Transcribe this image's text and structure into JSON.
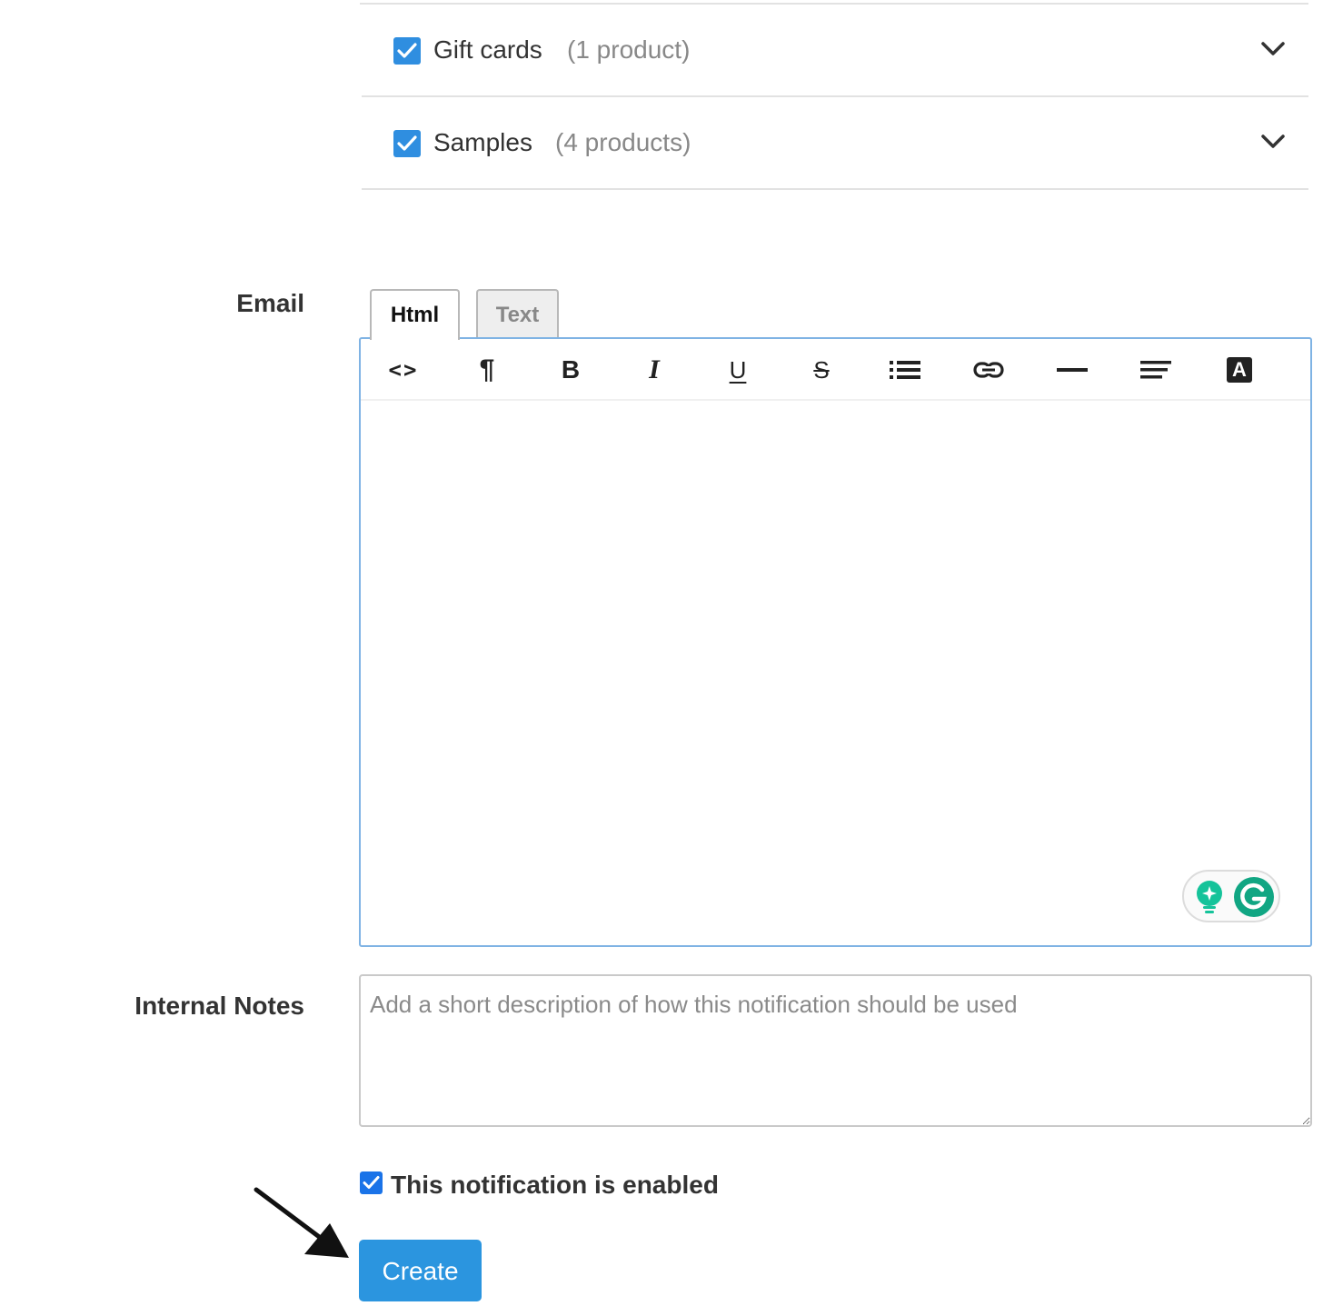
{
  "collections": [
    {
      "name": "Gift cards",
      "count": "(1 product)",
      "checked": true
    },
    {
      "name": "Samples",
      "count": "(4 products)",
      "checked": true
    }
  ],
  "email": {
    "label": "Email",
    "tabs": [
      {
        "label": "Html",
        "active": true
      },
      {
        "label": "Text",
        "active": false
      }
    ],
    "toolbar": [
      "code-view-icon",
      "paragraph-icon",
      "bold-icon",
      "italic-icon",
      "underline-icon",
      "strikethrough-icon",
      "bullet-list-icon",
      "link-icon",
      "horizontal-rule-icon",
      "align-icon",
      "text-color-icon"
    ],
    "toolbar_glyphs": {
      "code": "<>",
      "paragraph": "¶",
      "bold": "B",
      "italic": "I",
      "underline": "U",
      "strike": "S",
      "text_color": "A"
    }
  },
  "internal_notes": {
    "label": "Internal Notes",
    "placeholder": "Add a short description of how this notification should be used"
  },
  "enabled": {
    "label": "This notification is enabled",
    "checked": true
  },
  "create_button": {
    "label": "Create"
  },
  "colors": {
    "accent": "#2b95df",
    "checkbox": "#2f8ee0",
    "grammarly": "#15c39a"
  }
}
